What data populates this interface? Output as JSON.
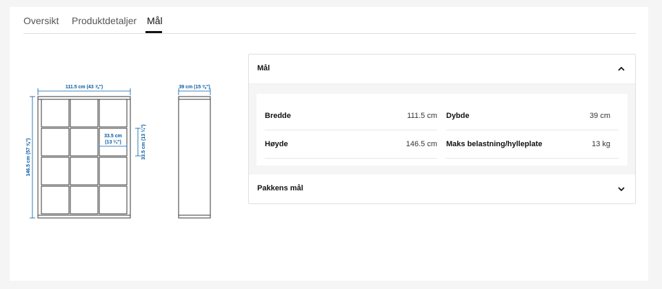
{
  "tabs": [
    {
      "label": "Oversikt"
    },
    {
      "label": "Produktdetaljer"
    },
    {
      "label": "Mål"
    }
  ],
  "diagram": {
    "width_label": "111.5 cm (43 ⅞\")",
    "depth_label": "39 cm (15 ⅜\")",
    "height_label": "146.5 cm (57 ⅝\")",
    "cell_width_label_1": "33.5 cm",
    "cell_width_label_2": "(13 ¼\")",
    "cell_height_label": "33.5 cm (13 ¼\")"
  },
  "dimensions": {
    "title": "Mål",
    "rows": [
      {
        "label": "Bredde",
        "value": "111.5 cm"
      },
      {
        "label": "Dybde",
        "value": "39 cm"
      },
      {
        "label": "Høyde",
        "value": "146.5 cm"
      },
      {
        "label": "Maks belastning/hylleplate",
        "value": "13 kg"
      }
    ]
  },
  "package": {
    "title": "Pakkens mål"
  },
  "colors": {
    "dimension_blue": "#0058a3",
    "line": "#333333"
  }
}
